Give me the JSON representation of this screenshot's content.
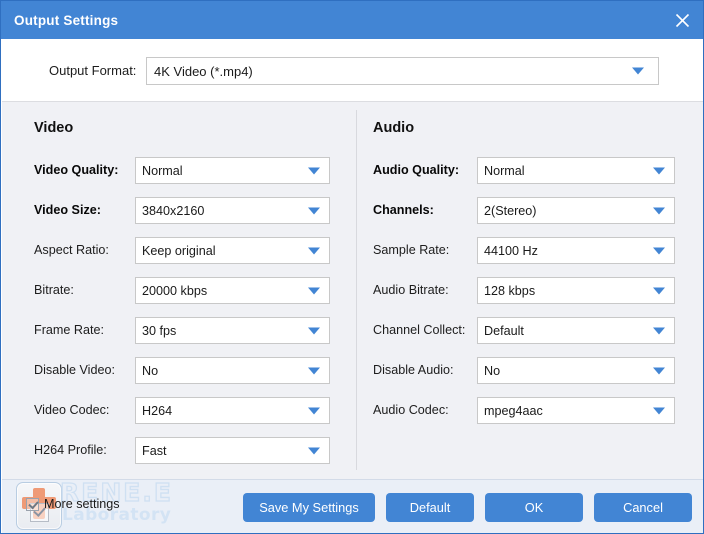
{
  "window": {
    "title": "Output Settings",
    "close_icon": "close-icon",
    "accent_color": "#4285d4",
    "panel_bg": "#f0f1f5",
    "footer_bg": "#eaeff7"
  },
  "output_format": {
    "label": "Output Format:",
    "value": "4K Video (*.mp4)",
    "arrow_icon": "chevron-down-icon"
  },
  "video": {
    "title": "Video",
    "rows": [
      {
        "label": "Video Quality:",
        "value": "Normal",
        "bold": true
      },
      {
        "label": "Video Size:",
        "value": "3840x2160",
        "bold": true
      },
      {
        "label": "Aspect Ratio:",
        "value": "Keep original",
        "bold": false
      },
      {
        "label": "Bitrate:",
        "value": "20000 kbps",
        "bold": false
      },
      {
        "label": "Frame Rate:",
        "value": "30 fps",
        "bold": false
      },
      {
        "label": "Disable Video:",
        "value": "No",
        "bold": false
      },
      {
        "label": "Video Codec:",
        "value": "H264",
        "bold": false
      },
      {
        "label": "H264 Profile:",
        "value": "Fast",
        "bold": false
      }
    ]
  },
  "audio": {
    "title": "Audio",
    "rows": [
      {
        "label": "Audio Quality:",
        "value": "Normal",
        "bold": true
      },
      {
        "label": "Channels:",
        "value": "2(Stereo)",
        "bold": true
      },
      {
        "label": "Sample Rate:",
        "value": "44100 Hz",
        "bold": false
      },
      {
        "label": "Audio Bitrate:",
        "value": "128 kbps",
        "bold": false
      },
      {
        "label": "Channel Collect:",
        "value": "Default",
        "bold": false
      },
      {
        "label": "Disable Audio:",
        "value": "No",
        "bold": false
      },
      {
        "label": "Audio Codec:",
        "value": "mpeg4aac",
        "bold": false
      }
    ]
  },
  "footer": {
    "more_settings_label": "More settings",
    "more_settings_checked": true,
    "buttons": {
      "save": "Save My Settings",
      "default": "Default",
      "ok": "OK",
      "cancel": "Cancel"
    },
    "watermark": {
      "brand": "RENE.E",
      "sub": "Laboratory",
      "icon": "first-aid-cross-icon"
    }
  }
}
